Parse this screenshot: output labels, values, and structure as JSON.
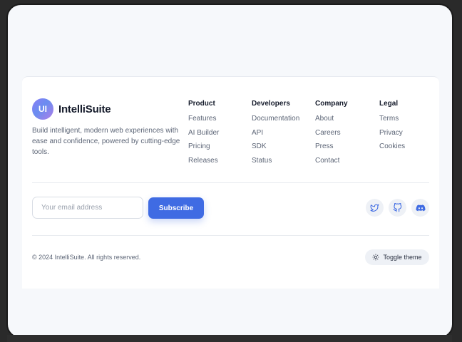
{
  "brand": {
    "logo_text": "UI",
    "name": "IntelliSuite",
    "description": "Build intelligent, modern web experiences with ease and confidence, powered by cutting-edge tools."
  },
  "columns": [
    {
      "title": "Product",
      "links": [
        "Features",
        "AI Builder",
        "Pricing",
        "Releases"
      ]
    },
    {
      "title": "Developers",
      "links": [
        "Documentation",
        "API",
        "SDK",
        "Status"
      ]
    },
    {
      "title": "Company",
      "links": [
        "About",
        "Careers",
        "Press",
        "Contact"
      ]
    },
    {
      "title": "Legal",
      "links": [
        "Terms",
        "Privacy",
        "Cookies"
      ]
    }
  ],
  "newsletter": {
    "placeholder": "Your email address",
    "button_label": "Subscribe"
  },
  "social": [
    "twitter-icon",
    "github-icon",
    "discord-icon"
  ],
  "copyright": "© 2024 IntelliSuite. All rights reserved.",
  "theme_toggle": {
    "label": "Toggle theme",
    "icon": "sun-icon"
  },
  "colors": {
    "accent": "#3f6be3",
    "icon": "#3f6be3",
    "text": "#5d6677",
    "heading": "#151b2b"
  }
}
